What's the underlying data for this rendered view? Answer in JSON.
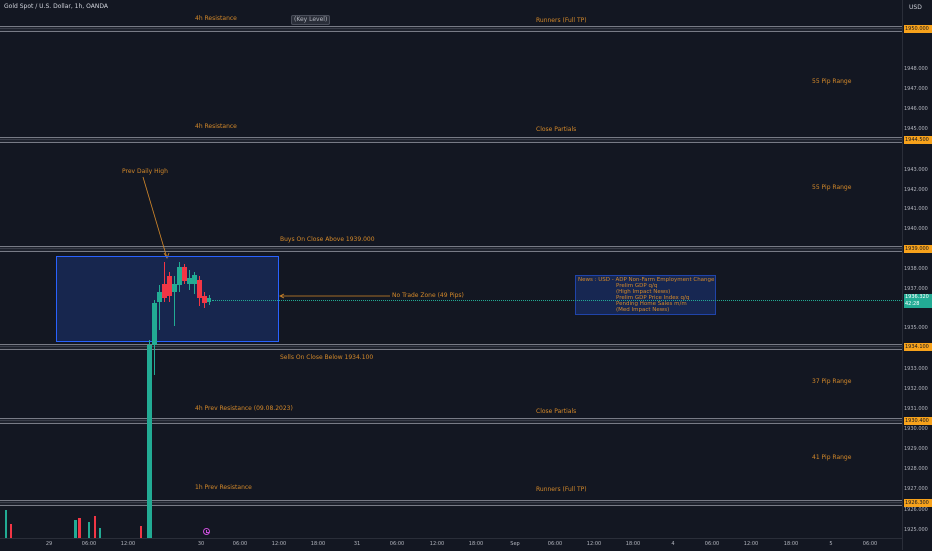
{
  "header": {
    "symbol": "Gold Spot / U.S. Dollar, 1h, OANDA",
    "currency": "USD"
  },
  "annotations": {
    "res4h_top": "4h Resistance",
    "key_level": "(Key Level)",
    "runners_top": "Runners (Full TP)",
    "range_55_a": "55 Pip Range",
    "res4h_2": "4h Resistance",
    "close_partials_1": "Close Partials",
    "prev_daily_high": "Prev Daily High",
    "range_55_b": "55 Pip Range",
    "buys": "Buys On Close Above 1939.000",
    "no_trade": "No Trade Zone (49 Pips)",
    "sells": "Sells On Close Below 1934.100",
    "range_37": "37 Pip Range",
    "prev_res": "4h Prev Resistance (09.08.2023)",
    "close_partials_2": "Close Partials",
    "range_41": "41 Pip Range",
    "res1h_prev": "1h Prev Resistance",
    "runners_bottom": "Runners (Full TP)"
  },
  "news": {
    "lines": [
      "News : USD - ADP Non-Farm Employment Change",
      "Prelim GDP q/q",
      "(High Impact News)",
      "Prelim GDP Price Index q/q",
      "Pending Home Sales m/m",
      "(Med Impact News)"
    ]
  },
  "price_axis": {
    "labels": [
      "1948.000",
      "1947.000",
      "1946.000",
      "1945.000",
      "1943.000",
      "1942.000",
      "1941.000",
      "1940.000",
      "1938.000",
      "1937.000",
      "1935.000",
      "1933.000",
      "1932.000",
      "1931.000",
      "1930.000",
      "1929.000",
      "1928.000",
      "1927.000",
      "1926.000",
      "1925.000"
    ],
    "tags": [
      "1950.000",
      "1944.500",
      "1939.000",
      "1934.100",
      "1930.400",
      "1926.300"
    ],
    "current_price": "1936.320",
    "countdown": "42:28"
  },
  "time_axis": {
    "labels": [
      "29",
      "06:00",
      "12:00",
      "30",
      "06:00",
      "12:00",
      "18:00",
      "31",
      "06:00",
      "12:00",
      "18:00",
      "Sep",
      "06:00",
      "12:00",
      "18:00",
      "4",
      "06:00",
      "12:00",
      "18:00",
      "5",
      "06:00"
    ]
  },
  "colors": {
    "up": "#22ab94",
    "down": "#f23645",
    "accent": "#f7a21b",
    "zone": "#2962ff"
  }
}
